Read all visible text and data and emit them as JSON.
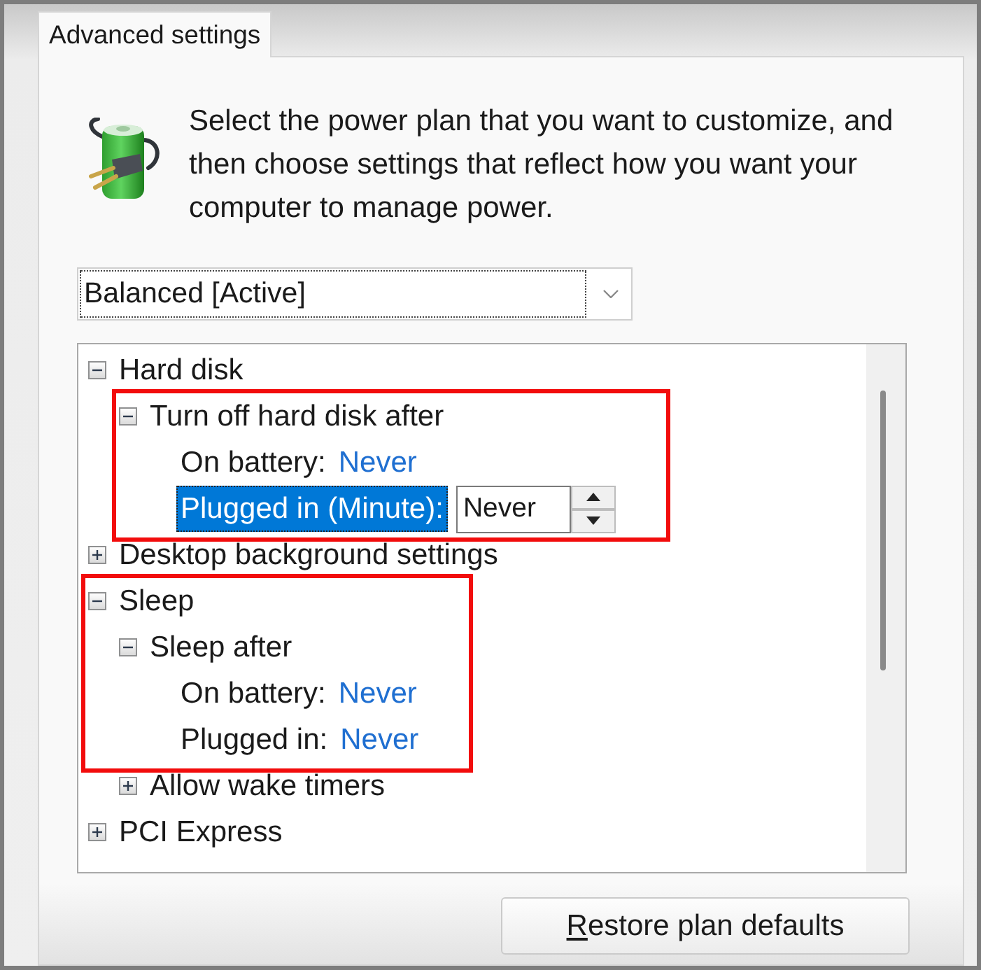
{
  "tab": {
    "label": "Advanced settings",
    "selected": true
  },
  "description": "Select the power plan that you want to customize, and then choose settings that reflect how you want your computer to manage power.",
  "plan_dropdown": {
    "value": "Balanced [Active]",
    "focused": true
  },
  "settings_tree": [
    {
      "kind": "group",
      "label": "Hard disk",
      "expanded": true,
      "selected": false,
      "highlighted": false,
      "children": [
        {
          "kind": "group",
          "label": "Turn off hard disk after",
          "expanded": true,
          "selected": false,
          "highlighted": true,
          "children": [
            {
              "kind": "setting",
              "label": "On battery:",
              "value": "Never",
              "selected": false,
              "highlighted": true
            },
            {
              "kind": "setting",
              "label": "Plugged in (Minute):",
              "value": "Never",
              "selected": true,
              "highlighted": true
            }
          ]
        }
      ]
    },
    {
      "kind": "group",
      "label": "Desktop background settings",
      "expanded": false,
      "selected": false,
      "highlighted": false
    },
    {
      "kind": "group",
      "label": "Sleep",
      "expanded": true,
      "selected": false,
      "highlighted": true,
      "children": [
        {
          "kind": "group",
          "label": "Sleep after",
          "expanded": true,
          "selected": false,
          "highlighted": true,
          "children": [
            {
              "kind": "setting",
              "label": "On battery:",
              "value": "Never",
              "selected": false,
              "highlighted": true
            },
            {
              "kind": "setting",
              "label": "Plugged in:",
              "value": "Never",
              "selected": false,
              "highlighted": true
            }
          ]
        },
        {
          "kind": "group",
          "label": "Allow wake timers",
          "expanded": false,
          "selected": false,
          "highlighted": false
        }
      ]
    },
    {
      "kind": "group",
      "label": "PCI Express",
      "expanded": false,
      "selected": false,
      "highlighted": false
    }
  ],
  "restore_button": {
    "label": "Restore plan defaults",
    "access_key_underlined": true
  }
}
